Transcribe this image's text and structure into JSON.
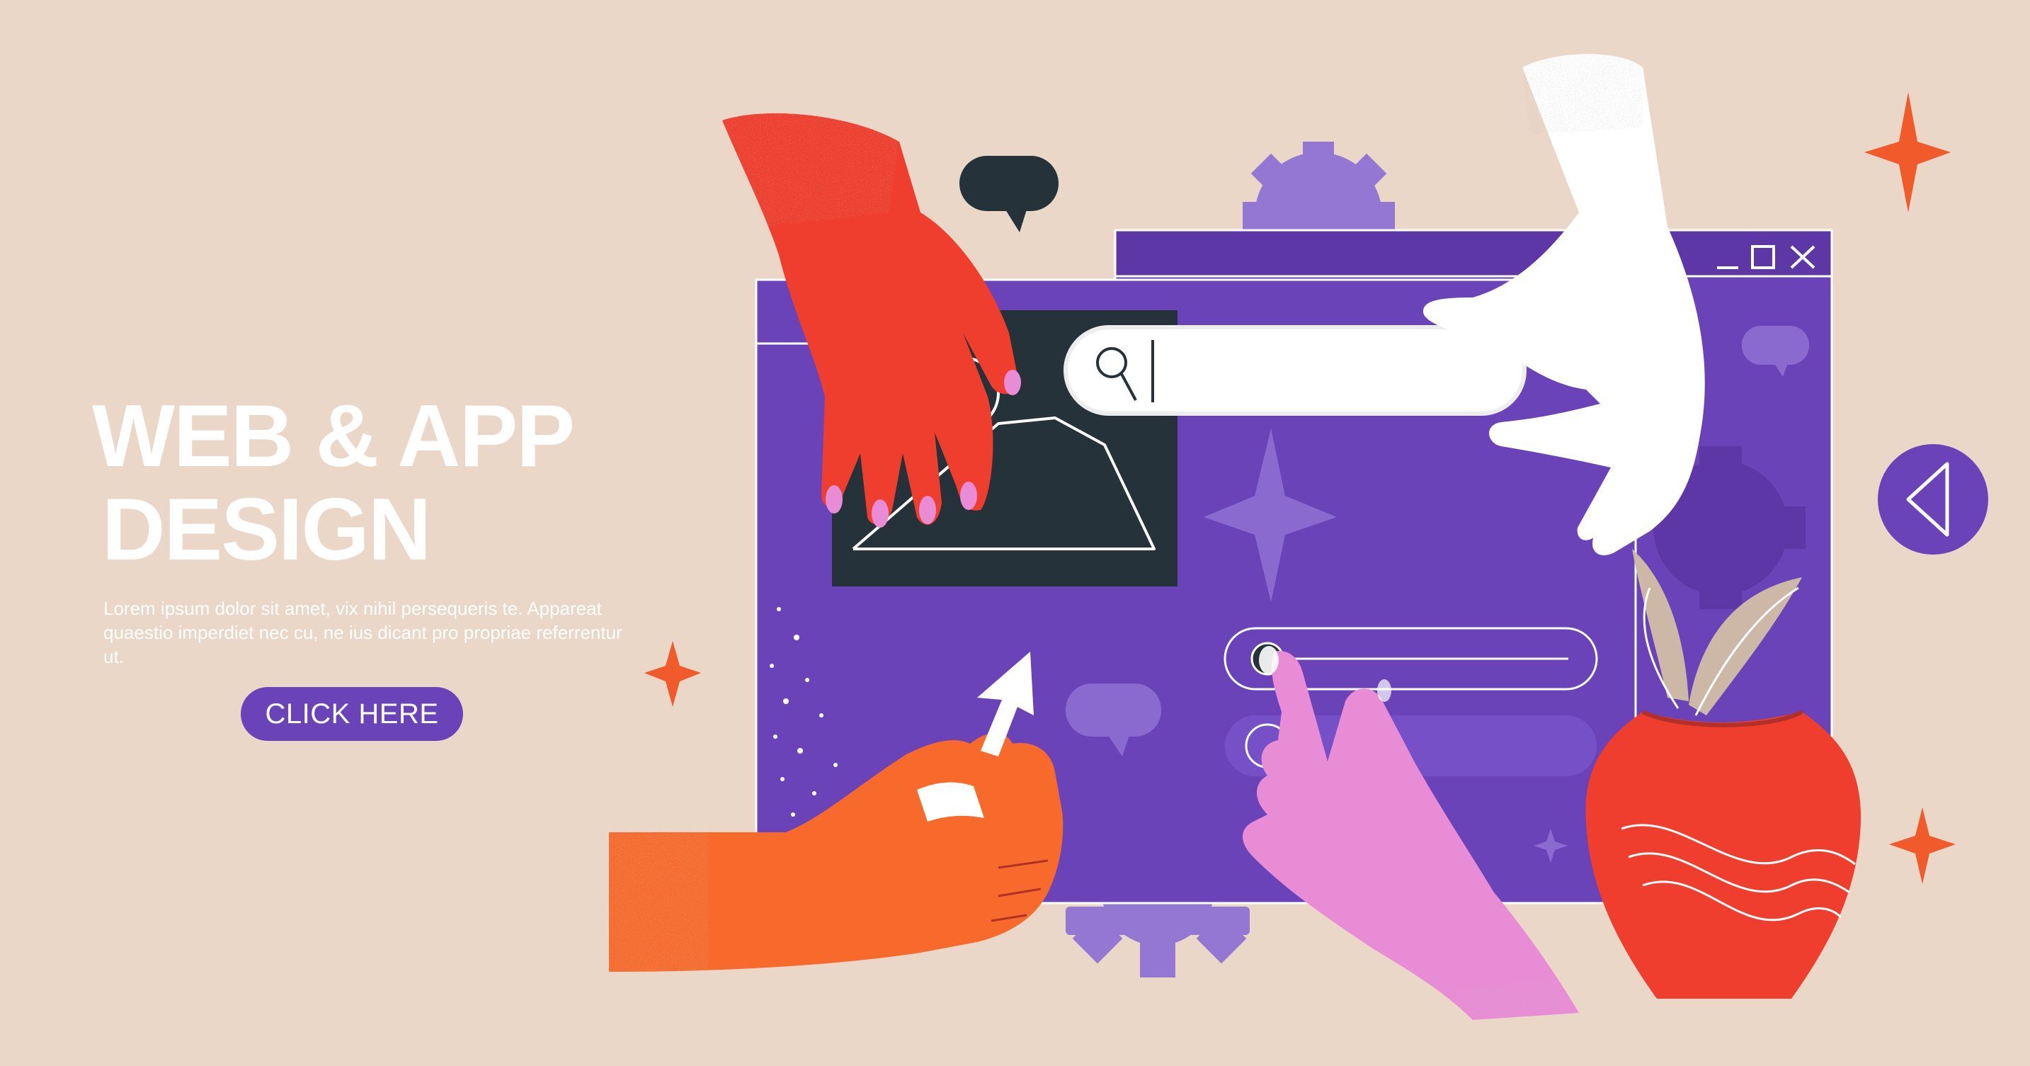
{
  "hero": {
    "title_line1": "WEB & APP",
    "title_line2": "DESIGN",
    "description": "Lorem ipsum dolor sit amet, vix nihil persequeris te. Appareat quaestio imperdiet nec cu, ne ius dicant pro propriae referrentur ut.",
    "cta_label": "CLICK HERE"
  },
  "search": {
    "value": ""
  },
  "colors": {
    "background": "#EAD7C8",
    "window_purple": "#6B43B8",
    "window_purple_dark": "#5E37A6",
    "accent_orange": "#F15A2B",
    "hand_red": "#EF3E2E",
    "hand_orange": "#F86A2C",
    "hand_pink": "#E98CD6",
    "hand_white": "#FFFFFF",
    "dark": "#25323A",
    "light_purple": "#8B6AD0"
  },
  "icons": [
    "search-icon",
    "minimize-icon",
    "maximize-icon",
    "close-icon",
    "back-arrow-icon",
    "gear-icon",
    "speech-bubble-icon",
    "star-icon",
    "image-placeholder-icon",
    "cursor-arrow-icon"
  ]
}
